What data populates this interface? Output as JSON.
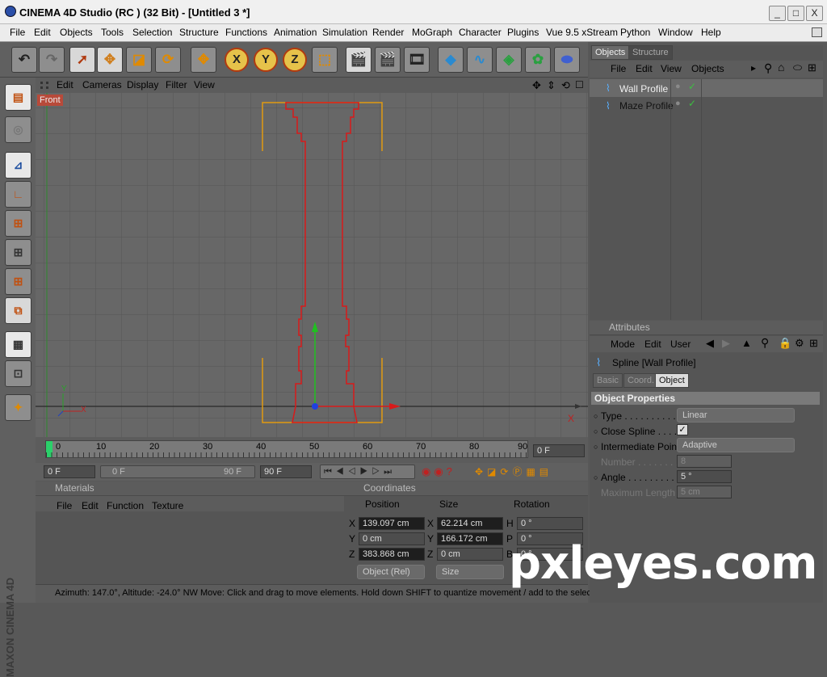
{
  "window": {
    "title": "CINEMA 4D Studio (RC ) (32 Bit) - [Untitled 3 *]",
    "minimize": "_",
    "maximize": "□",
    "close": "X"
  },
  "menu": [
    "File",
    "Edit",
    "Objects",
    "Tools",
    "Selection",
    "Structure",
    "Functions",
    "Animation",
    "Simulation",
    "Render",
    "MoGraph",
    "Character",
    "Plugins",
    "Vue 9.5 xStream",
    "Python",
    "Window",
    "Help"
  ],
  "toolbar": {
    "x_label": "X",
    "y_label": "Y",
    "z_label": "Z"
  },
  "viewport": {
    "menu": [
      "Edit",
      "Cameras",
      "Display",
      "Filter",
      "View"
    ],
    "label": "Front",
    "axis_x": "X",
    "axis_y": "Y"
  },
  "timeline": {
    "ticks": [
      "0",
      "10",
      "20",
      "30",
      "40",
      "50",
      "60",
      "70",
      "80",
      "90"
    ],
    "current_frame": "0 F"
  },
  "transport": {
    "start": "0 F",
    "range_start": "0 F",
    "range_end": "90 F",
    "end": "90 F"
  },
  "materials": {
    "title": "Materials",
    "menu": [
      "File",
      "Edit",
      "Function",
      "Texture"
    ]
  },
  "coordinates": {
    "title": "Coordinates",
    "headers": [
      "Position",
      "Size",
      "Rotation"
    ],
    "rows": [
      {
        "pos_label": "X",
        "pos": "139.097 cm",
        "size_label": "X",
        "size": "62.214 cm",
        "rot_label": "H",
        "rot": "0 °"
      },
      {
        "pos_label": "Y",
        "pos": "0 cm",
        "size_label": "Y",
        "size": "166.172 cm",
        "rot_label": "P",
        "rot": "0 °"
      },
      {
        "pos_label": "Z",
        "pos": "383.868 cm",
        "size_label": "Z",
        "size": "0 cm",
        "rot_label": "B",
        "rot": "0 °"
      }
    ],
    "mode": "Object (Rel)",
    "size_mode": "Size"
  },
  "objects_panel": {
    "tabs": [
      "Objects",
      "Structure"
    ],
    "menu": [
      "File",
      "Edit",
      "View",
      "Objects"
    ],
    "items": [
      "Wall Profile",
      "Maze Profile"
    ]
  },
  "attributes": {
    "title": "Attributes",
    "menu": [
      "Mode",
      "Edit",
      "User"
    ],
    "object": "Spline [Wall Profile]",
    "tabs": [
      "Basic",
      "Coord.",
      "Object"
    ],
    "section": "Object Properties",
    "props": [
      {
        "label": "Type . . . . . . . . . .",
        "value": "Linear"
      },
      {
        "label": "Close Spline . . . . .",
        "value": "✓"
      },
      {
        "label": "Intermediate Points",
        "value": "Adaptive"
      },
      {
        "label": "Number . . . . . . . .",
        "value": "8"
      },
      {
        "label": "Angle . . . . . . . . . .",
        "value": "5 °"
      },
      {
        "label": "Maximum Length",
        "value": "5 cm"
      }
    ]
  },
  "status": "Azimuth: 147.0°, Altitude: -24.0°  NW  Move: Click and drag to move elements. Hold down SHIFT to quantize movement / add to the selec",
  "brand": "MAXON CINEMA 4D",
  "watermark": "pxleyes.com"
}
